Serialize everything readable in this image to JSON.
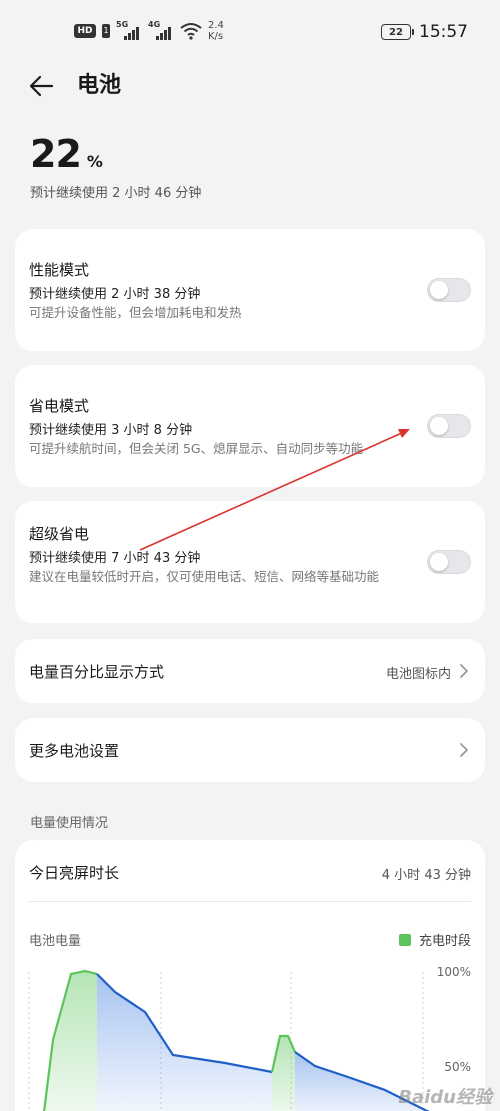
{
  "status_bar": {
    "hd": "HD",
    "sim": "1",
    "sig1": "5G",
    "sig2": "4G",
    "speed_value": "2.4",
    "speed_unit": "K/s",
    "battery_level": "22",
    "time": "15:57"
  },
  "header": {
    "title": "电池",
    "back_icon": "arrow-left-icon"
  },
  "battery": {
    "percent": "22",
    "unit": "%",
    "estimate": "预计继续使用 2 小时 46 分钟"
  },
  "modes": [
    {
      "title": "性能模式",
      "estimate": "预计继续使用 2 小时 38 分钟",
      "desc": "可提升设备性能，但会增加耗电和发热",
      "enabled": false
    },
    {
      "title": "省电模式",
      "estimate": "预计继续使用 3 小时 8 分钟",
      "desc": "可提升续航时间，但会关闭 5G、熄屏显示、自动同步等功能",
      "enabled": false
    },
    {
      "title": "超级省电",
      "estimate": "预计继续使用 7 小时 43 分钟",
      "desc": "建议在电量较低时开启，仅可使用电话、短信、网络等基础功能",
      "enabled": false
    }
  ],
  "rows": {
    "percent_display": {
      "label": "电量百分比显示方式",
      "value": "电池图标内"
    },
    "more_settings": {
      "label": "更多电池设置"
    }
  },
  "usage": {
    "section_label": "电量使用情况",
    "screen_on_label": "今日亮屏时长",
    "screen_on_value": "4 小时 43 分钟",
    "chart_label": "电池电量",
    "legend_charging": "充电时段",
    "tick_100": "100%",
    "tick_50": "50%"
  },
  "watermark": "Baidu经验",
  "colors": {
    "accent_line": "#1f5fc8",
    "charging": "#5cc45c",
    "annotation_arrow": "#d9342b"
  }
}
